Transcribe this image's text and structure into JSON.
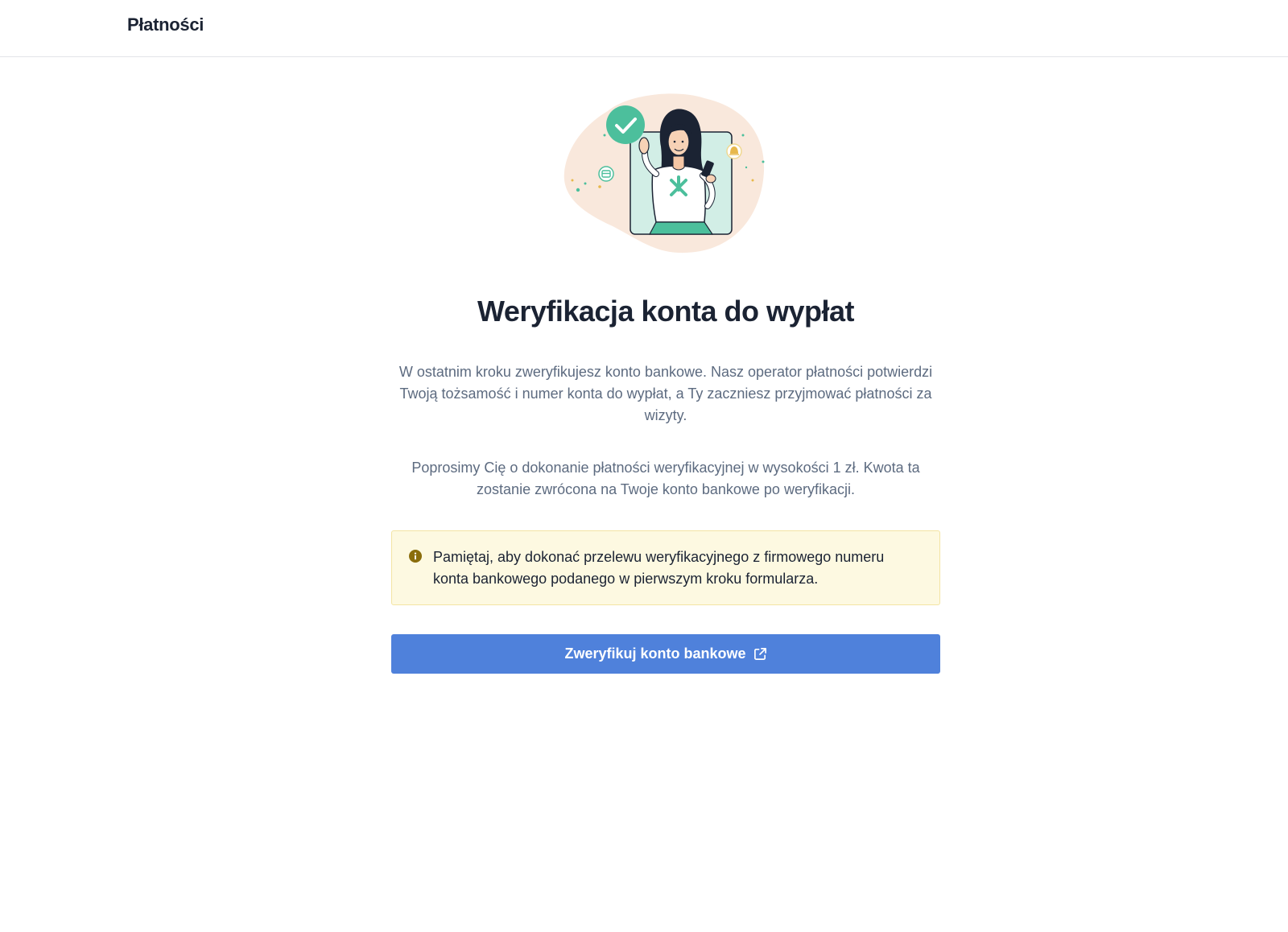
{
  "header": {
    "title": "Płatności"
  },
  "main": {
    "illustration_icon": "woman-with-phone-verified-illustration",
    "heading": "Weryfikacja konta do wypłat",
    "paragraph_1": "W ostatnim kroku zweryfikujesz konto bankowe. Nasz operator płatności potwierdzi Twoją tożsamość i numer konta do wypłat, a Ty zaczniesz przyjmować płatności za wizyty.",
    "paragraph_2": "Poprosimy Cię o dokonanie płatności weryfikacyjnej w wysokości 1 zł. Kwota ta zostanie zwrócona na Twoje konto bankowe po weryfikacji.",
    "alert": {
      "icon": "info-icon",
      "text": "Pamiętaj, aby dokonać przelewu weryfikacyjnego z firmowego numeru konta bankowego podanego w pierwszym kroku formularza."
    },
    "cta": {
      "label": "Zweryfikuj konto bankowe",
      "icon": "external-link-icon"
    }
  },
  "colors": {
    "accent": "#4f81db",
    "heading": "#1b2333",
    "body_text": "#5d6b80",
    "alert_background": "#fdf9e1",
    "alert_border": "#f3e4a3",
    "alert_icon": "#8a6d0b",
    "illustration_teal": "#4cbf9c",
    "illustration_blob": "#f9e8dc"
  }
}
